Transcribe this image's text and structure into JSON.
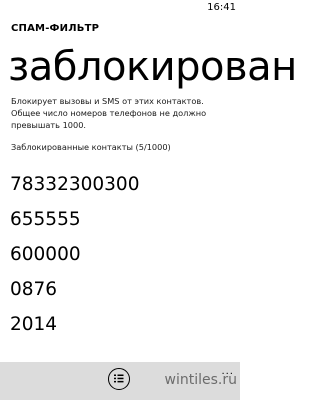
{
  "status_bar": {
    "time": "16:41"
  },
  "header": {
    "app_title": "СПАМ-ФИЛЬТР",
    "page_title": "заблокирован"
  },
  "main": {
    "description": "Блокирует вызовы и SMS от этих контактов. Общее число номеров телефонов не должно превышать 1000.",
    "list_header": "Заблокированные контакты (5/1000)",
    "contacts": [
      "78332300300",
      "655555",
      "600000",
      "0876",
      "2014"
    ]
  },
  "app_bar": {
    "button_icon": "list-select-icon",
    "more_icon": "more-dots-icon",
    "more_label": "...",
    "background": "#dcdcdc"
  },
  "watermark": {
    "text": "wintiles.ru"
  }
}
